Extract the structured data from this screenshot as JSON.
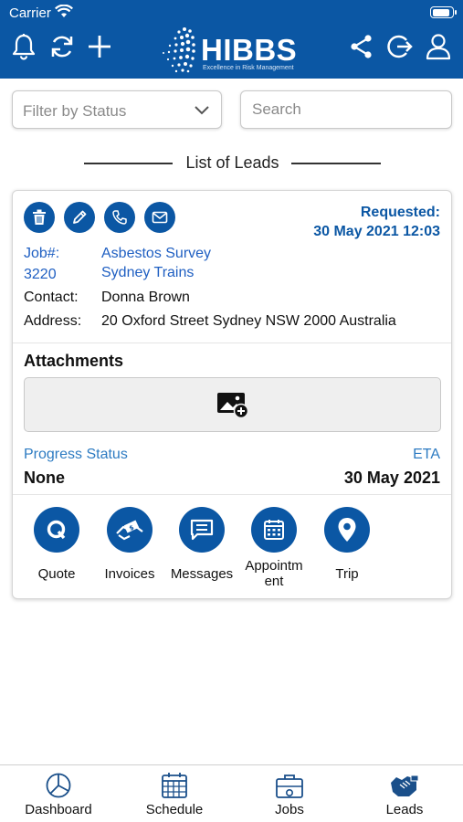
{
  "status_bar": {
    "carrier": "Carrier"
  },
  "header": {
    "brand": "HIBBS",
    "tagline": "Excellence in Risk Management",
    "icons": [
      "bell-icon",
      "refresh-icon",
      "plus-icon",
      "share-icon",
      "logout-icon",
      "user-icon"
    ],
    "color": "#0b57a4"
  },
  "filters": {
    "status_placeholder": "Filter by Status",
    "search_placeholder": "Search"
  },
  "list_title": "List of Leads",
  "lead": {
    "requested_label": "Requested:",
    "requested_date": "30 May 2021 12:03",
    "job_label": "Job#:",
    "job_number": "3220",
    "job_title": "Asbestos Survey",
    "client": "Sydney Trains",
    "contact_label": "Contact:",
    "contact_value": "Donna Brown",
    "address_label": "Address:",
    "address_value": "20 Oxford Street Sydney NSW 2000 Australia",
    "attachments_label": "Attachments",
    "progress_label": "Progress Status",
    "progress_value": "None",
    "eta_label": "ETA",
    "eta_value": "30 May 2021",
    "features": [
      {
        "label": "Quote",
        "icon": "quote-icon"
      },
      {
        "label": "Invoices",
        "icon": "invoice-icon"
      },
      {
        "label": "Messages",
        "icon": "message-icon"
      },
      {
        "label": "Appointm\nent",
        "icon": "calendar-icon"
      },
      {
        "label": "Trip",
        "icon": "location-pin-icon"
      }
    ]
  },
  "tabs": [
    {
      "label": "Dashboard",
      "icon": "pie-chart-icon"
    },
    {
      "label": "Schedule",
      "icon": "calendar-icon"
    },
    {
      "label": "Jobs",
      "icon": "briefcase-icon"
    },
    {
      "label": "Leads",
      "icon": "handshake-icon"
    }
  ]
}
